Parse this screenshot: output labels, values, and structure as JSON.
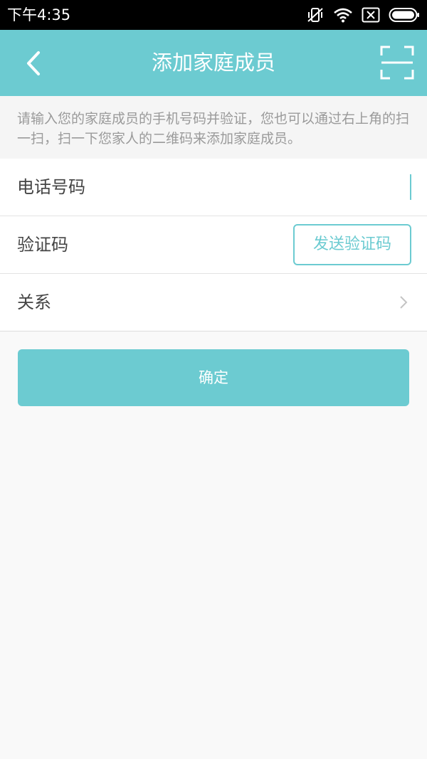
{
  "status_bar": {
    "time": "下午4:35",
    "icons": [
      "mute-vibrate-icon",
      "wifi-icon",
      "sim-off-icon",
      "battery-icon"
    ]
  },
  "header": {
    "title": "添加家庭成员",
    "back_icon": "chevron-left-icon",
    "scan_icon": "scan-icon"
  },
  "hint": {
    "text": "请输入您的家庭成员的手机号码并验证，您也可以通过右上角的扫一扫，扫一下您家人的二维码来添加家庭成员。"
  },
  "form": {
    "phone_label": "电话号码",
    "phone_value": "",
    "code_label": "验证码",
    "code_value": "",
    "send_code_label": "发送验证码",
    "relation_label": "关系"
  },
  "confirm_label": "确定",
  "colors": {
    "accent": "#6ccbd1",
    "status_bar": "#000000",
    "background": "#f9f9f9"
  }
}
